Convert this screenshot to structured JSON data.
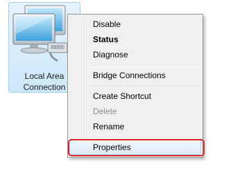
{
  "network_item": {
    "label_line1": "Local Area",
    "label_line2": "Connection",
    "icon": "network-connection-icon"
  },
  "context_menu": {
    "items": [
      {
        "label": "Disable",
        "bold": false,
        "enabled": true
      },
      {
        "label": "Status",
        "bold": true,
        "enabled": true
      },
      {
        "label": "Diagnose",
        "bold": false,
        "enabled": true
      },
      {
        "label": "Bridge Connections",
        "bold": false,
        "enabled": true
      },
      {
        "label": "Create Shortcut",
        "bold": false,
        "enabled": true
      },
      {
        "label": "Delete",
        "bold": false,
        "enabled": false
      },
      {
        "label": "Rename",
        "bold": false,
        "enabled": true
      },
      {
        "label": "Properties",
        "bold": false,
        "enabled": true,
        "highlighted": true
      }
    ]
  },
  "annotation": {
    "color": "#d9262b",
    "target": "Properties"
  }
}
